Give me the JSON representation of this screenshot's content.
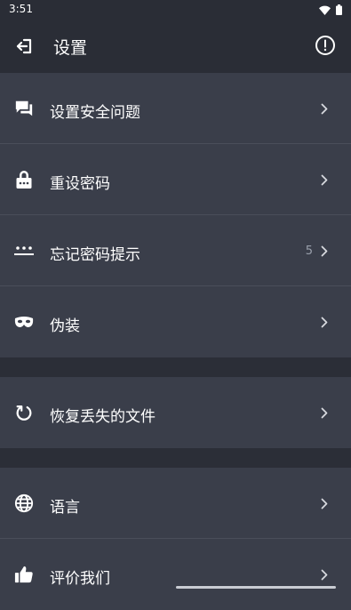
{
  "status_bar": {
    "time": "3:51"
  },
  "app_bar": {
    "title": "设置"
  },
  "sections": [
    {
      "items": [
        {
          "icon": "chat-bubbles-icon",
          "label": "设置安全问题"
        },
        {
          "icon": "lock-icon",
          "label": "重设密码"
        },
        {
          "icon": "password-dots-icon",
          "label": "忘记密码提示",
          "badge": "5"
        },
        {
          "icon": "mask-icon",
          "label": "伪装"
        }
      ]
    },
    {
      "items": [
        {
          "icon": "restore-icon",
          "label": "恢复丢失的文件"
        }
      ]
    },
    {
      "items": [
        {
          "icon": "globe-icon",
          "label": "语言"
        },
        {
          "icon": "thumbs-up-icon",
          "label": "评价我们"
        }
      ]
    }
  ],
  "colors": {
    "background": "#2b2e37",
    "row": "#3a3e4a",
    "divider": "#4a4e5a",
    "text": "#ffffff",
    "badge": "#9aa0ac"
  }
}
